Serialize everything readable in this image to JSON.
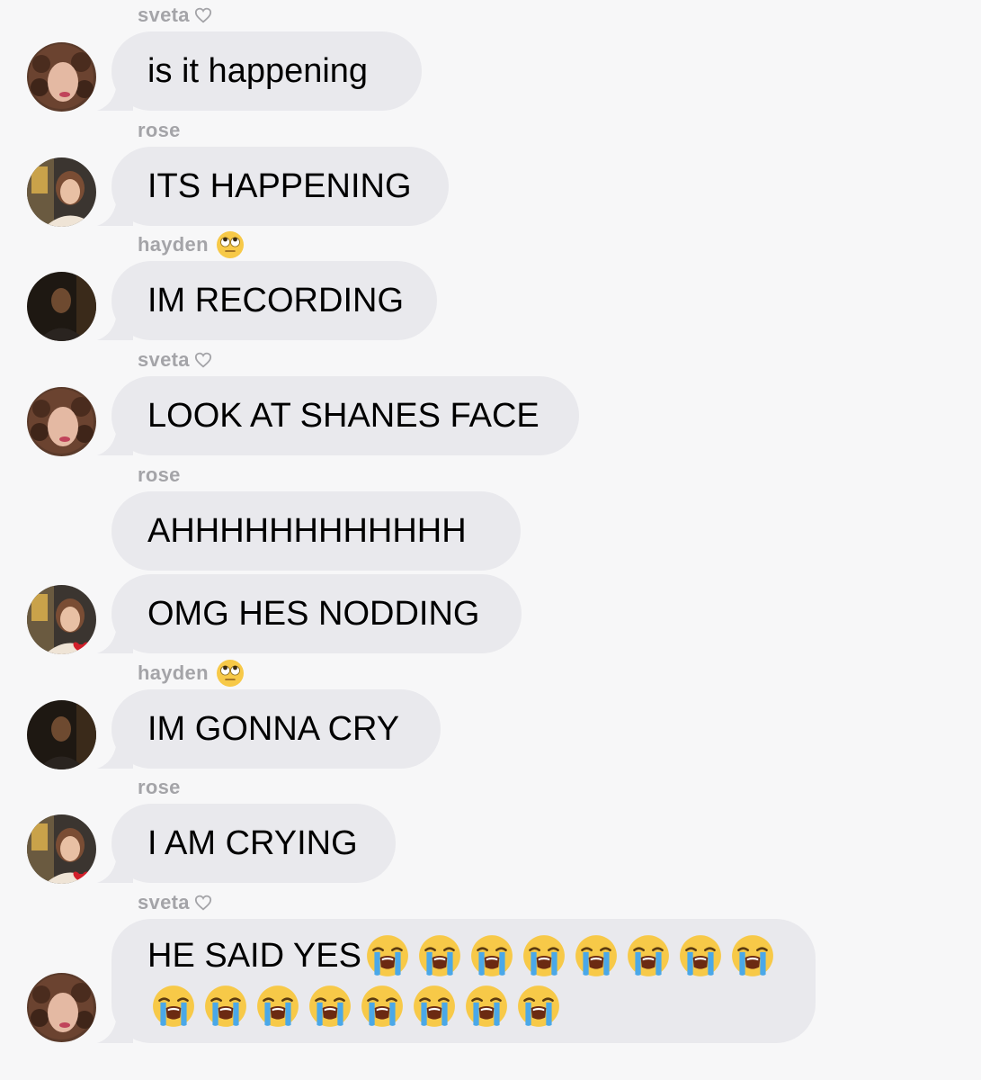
{
  "messages": [
    {
      "sender": "sveta",
      "sender_icon": "heart-outline-icon",
      "text": "is it happening"
    },
    {
      "sender": "rose",
      "text": "ITS HAPPENING"
    },
    {
      "sender": "hayden",
      "sender_icon": "rolling-eyes-emoji-icon",
      "text": "IM RECORDING"
    },
    {
      "sender": "sveta",
      "sender_icon": "heart-outline-icon",
      "text": "LOOK AT SHANES FACE"
    },
    {
      "sender": "rose",
      "text": "AHHHHHHHHHHHH"
    },
    {
      "text": "OMG HES NODDING"
    },
    {
      "sender": "hayden",
      "sender_icon": "rolling-eyes-emoji-icon",
      "text": "IM GONNA CRY"
    },
    {
      "sender": "rose",
      "text": "I AM CRYING"
    },
    {
      "sender": "sveta",
      "sender_icon": "heart-outline-icon",
      "text": "HE SAID YES",
      "emoji": "loudly-crying-face-emoji-icon",
      "emoji_count": 16
    }
  ],
  "colors": {
    "background": "#f7f7f8",
    "bubble": "#e9e9ed",
    "sender_name": "#a4a4a8",
    "text": "#000000"
  }
}
